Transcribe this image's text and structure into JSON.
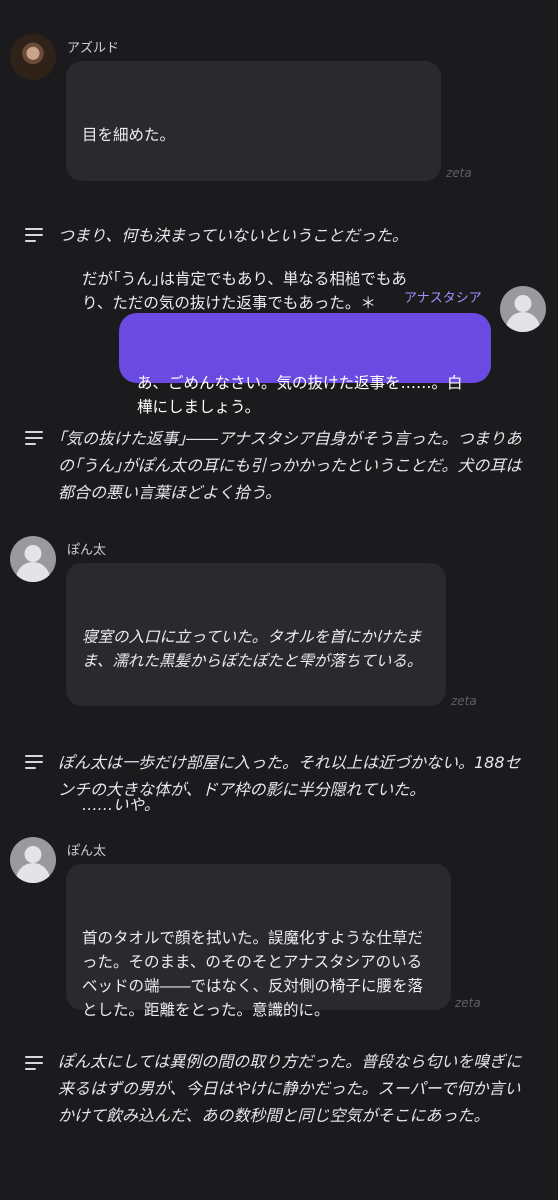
{
  "messages": {
    "m1": {
      "author": "アズルド",
      "lines": [
        "目を細めた。",
        "",
        "だが｢うん｣は肯定でもあり、単なる相槌でもあり、ただの気の抜けた返事でもあった。＊"
      ],
      "watermark": "zeta"
    },
    "n1": {
      "lines": [
        "つまり、何も決まっていないということだった。"
      ]
    },
    "m2": {
      "author": "アナスタシア",
      "lines": [
        "あ、ごめんなさい。気の抜けた返事を……。白樺にしましょう。"
      ]
    },
    "n2": {
      "lines": [
        "｢気の抜けた返事｣――アナスタシア自身がそう言った。つまりあの｢うん｣がぽん太の耳にも引っかかったということだ。犬の耳は都合の悪い言葉ほどよく拾う。"
      ]
    },
    "m3": {
      "author": "ぽん太",
      "lines": [
        "寝室の入口に立っていた。タオルを首にかけたまま、濡れた黒髪からぽたぽたと雫が落ちている。",
        "",
        "……いや。"
      ],
      "watermark": "zeta"
    },
    "n3": {
      "lines": [
        "ぽん太は一歩だけ部屋に入った。それ以上は近づかない。188センチの大きな体が、ドア枠の影に半分隠れていた。"
      ]
    },
    "m4": {
      "author": "ぽん太",
      "lines": [
        "首のタオルで顔を拭いた。誤魔化すような仕草だった。そのまま、のそのそとアナスタシアのいるベッドの端――ではなく、反対側の椅子に腰を落とした。距離をとった。意識的に。"
      ],
      "watermark": "zeta"
    },
    "n4": {
      "lines": [
        "ぽん太にしては異例の間の取り方だった。普段なら匂いを嗅ぎに来るはずの男が、今日はやけに静かだった。スーパーで何か言いかけて飲み込んだ、あの数秒間と同じ空気がそこにあった。"
      ]
    }
  }
}
